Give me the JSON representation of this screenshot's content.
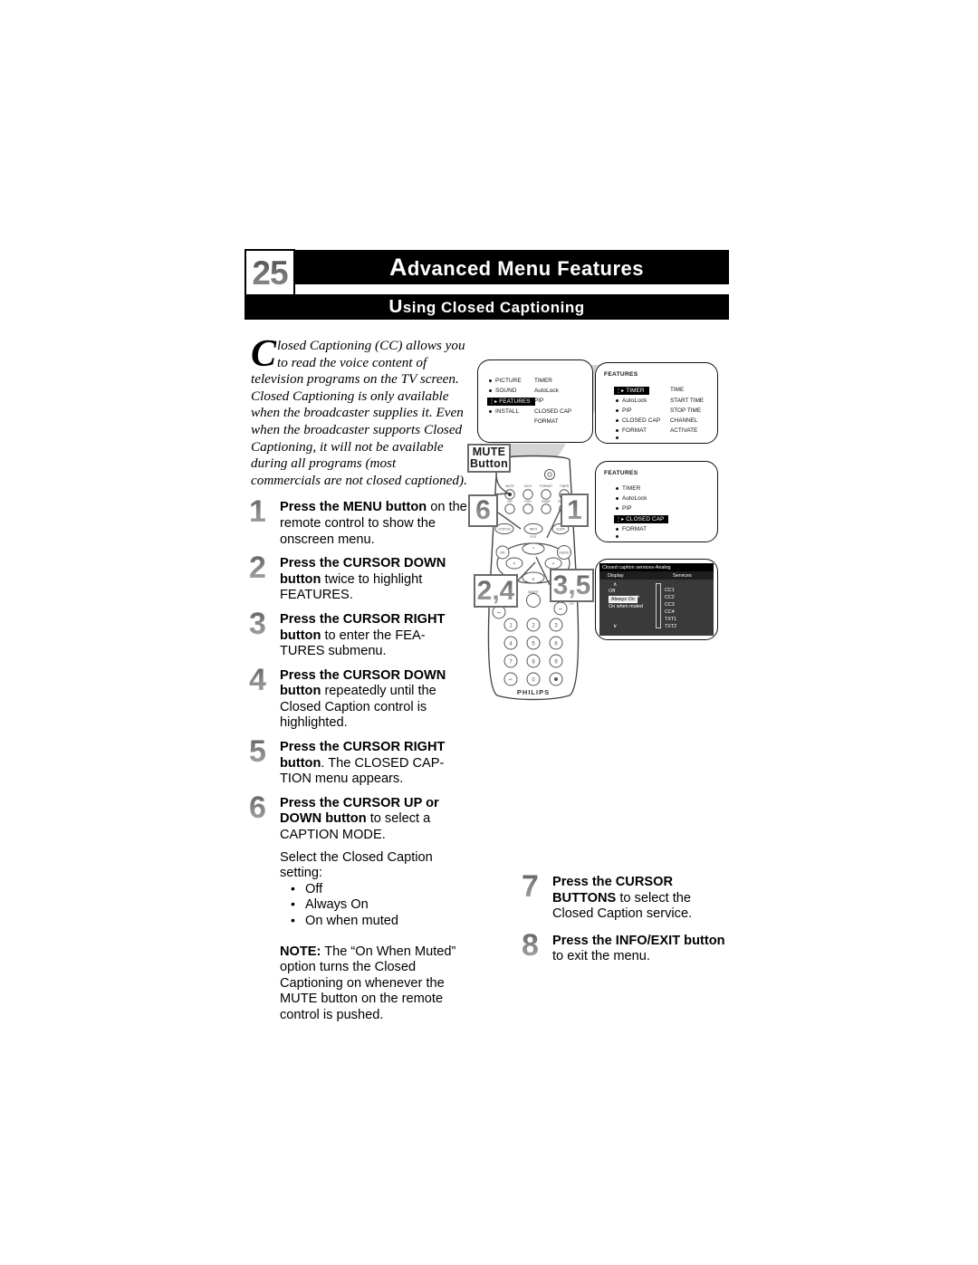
{
  "header": {
    "page_number": "25",
    "main_title": "Advanced Menu Features",
    "sub_title": "Using Closed Captioning"
  },
  "intro": {
    "dropcap": "C",
    "text": "losed Captioning (CC) allows you to read the voice content of television programs on the TV screen.  Closed Captioning is only available when the broadcaster supplies it.  Even when the broadcaster supports Closed Captioning, it will not be available during all programs (most commercials are not closed captioned)."
  },
  "steps": [
    {
      "num": "1",
      "bold1": "Press the MENU button",
      "rest": " on the remote control to show the onscreen menu."
    },
    {
      "num": "2",
      "bold1": "Press the CURSOR DOWN button",
      "rest": " twice to highlight FEATURES."
    },
    {
      "num": "3",
      "bold1": "Press the CURSOR RIGHT button",
      "rest": " to enter the FEA-TURES submenu."
    },
    {
      "num": "4",
      "bold1": "Press the CURSOR DOWN button",
      "rest": " repeatedly until the Closed Caption control is highlighted."
    },
    {
      "num": "5",
      "bold1": "Press the CURSOR RIGHT button",
      "rest": ". The CLOSED CAP-TION menu appears."
    },
    {
      "num": "6",
      "bold1": "Press the CURSOR UP or DOWN button",
      "rest": " to select a CAPTION MODE."
    }
  ],
  "select_setting": {
    "lead": "Select the Closed Caption setting:",
    "options": [
      "Off",
      "Always On",
      "On when muted"
    ]
  },
  "note": {
    "label": "NOTE:",
    "text": "  The “On When Muted” option turns the Closed Captioning on whenever the MUTE button on the remote control is pushed."
  },
  "right_steps": [
    {
      "num": "7",
      "bold1": "Press the CURSOR BUTTONS",
      "rest": " to select the Closed Caption service."
    },
    {
      "num": "8",
      "bold1": "Press the INFO/EXIT button",
      "rest": " to exit the menu."
    }
  ],
  "tv_screens": {
    "screen1": {
      "left_items": [
        "PICTURE",
        "SOUND",
        "FEATURES",
        "INSTALL"
      ],
      "highlighted": "FEATURES",
      "right_items": [
        "TIMER",
        "AutoLock",
        "PIP",
        "CLOSED CAP",
        "FORMAT"
      ]
    },
    "screen2": {
      "title": "FEATURES",
      "left_items": [
        "TIMER",
        "AutoLock",
        "PIP",
        "CLOSED CAP",
        "FORMAT",
        ""
      ],
      "highlighted": "TIMER",
      "right_items": [
        "TIME",
        "START TIME",
        "STOP TIME",
        "CHANNEL",
        "ACTIVATE"
      ]
    },
    "screen3": {
      "title": "FEATURES",
      "left_items": [
        "TIMER",
        "AutoLock",
        "PIP",
        "CLOSED CAP",
        "FORMAT",
        ""
      ],
      "highlighted": "CLOSED CAP"
    },
    "screen4": {
      "title": "Closed caption services-Analog",
      "col_display": "Display",
      "col_services": "Services",
      "scroll_up": "∧",
      "scroll_down": "∨",
      "display_options": [
        "Off",
        "Always On",
        "On when muted"
      ],
      "display_selected": "Always On",
      "select_arrow": ">",
      "services": [
        "CC1",
        "CC2",
        "CC3",
        "CC4",
        "TXT1",
        "TXT2"
      ]
    }
  },
  "callouts": {
    "mute_line1": "MUTE",
    "mute_line2": "Button",
    "c6": "6",
    "c1": "1",
    "c24": "2,4",
    "c35": "3,5"
  },
  "remote": {
    "brand": "PHILIPS",
    "keypad": [
      "1",
      "2",
      "3",
      "4",
      "5",
      "6",
      "7",
      "8",
      "9",
      "↵",
      "0",
      "•"
    ],
    "ok_label": "OK",
    "menu_label": "MENU",
    "info_label": "INFO",
    "exit_label": "EXIT",
    "surf_label": "SURF",
    "status_label": "STATUS",
    "top_row1": [
      "MUTE",
      "A/CH",
      "FORMAT",
      "TIMER"
    ],
    "top_row2": [
      "PIP",
      "POS",
      "SWAP",
      "FREEZE"
    ],
    "vol_plus": "+",
    "vol_minus": "−",
    "ch_plus": "+",
    "ch_minus": "−",
    "smart_label": "SMART"
  },
  "colors": {
    "bar_bg": "#000000",
    "bar_text": "#ffffff",
    "callout_border": "#6b6b6b",
    "numeral_gray": "#8b8b8b",
    "wedge_gray": "#d4d4d4",
    "cc_panel_bg": "#3a3a3a",
    "cc_titlebar_bg": "#000000"
  }
}
